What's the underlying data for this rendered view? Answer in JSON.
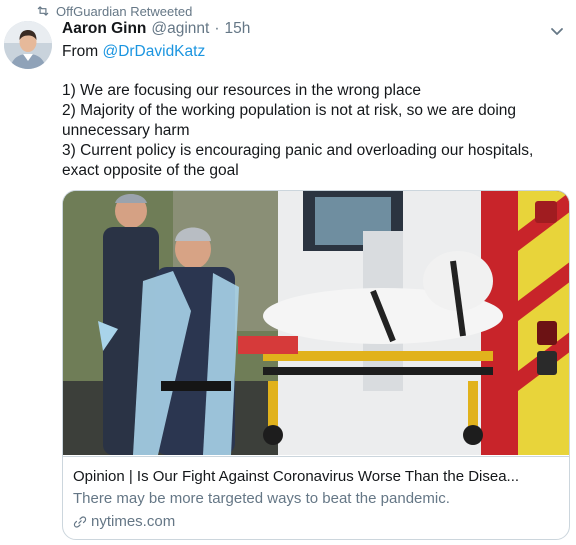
{
  "retweet": {
    "label": "OffGuardian Retweeted"
  },
  "tweet": {
    "author_name": "Aaron Ginn",
    "author_handle": "@aginnt",
    "separator": "·",
    "time": "15h",
    "from_prefix": "From ",
    "from_mention": "@DrDavidKatz",
    "lines": [
      "1) We are focusing our resources in the wrong place",
      "2) Majority of the working population is not at risk, so we are doing unnecessary harm",
      "3) Current policy is encouraging panic and overloading our hospitals, exact opposite of the goal"
    ]
  },
  "card": {
    "title": "Opinion | Is Our Fight Against Coronavirus Worse Than the Disea...",
    "description": "There may be more targeted ways to beat the pandemic.",
    "domain": "nytimes.com"
  },
  "icons": {
    "retweet": "retweet-icon",
    "caret": "chevron-down-icon",
    "link": "link-icon"
  },
  "colors": {
    "accent": "#1b95e0",
    "secondary_text": "#657786",
    "primary_text": "#14171a",
    "border": "#ccd6dd"
  }
}
